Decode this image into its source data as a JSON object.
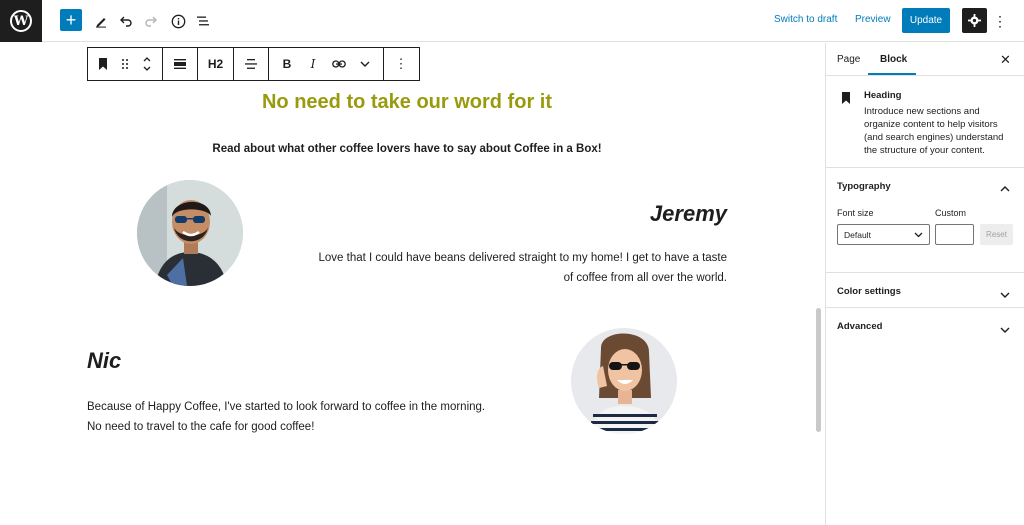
{
  "topbar": {
    "logo_letter": "W",
    "inserter_label": "+",
    "switch_to_draft": "Switch to draft",
    "preview": "Preview",
    "update": "Update"
  },
  "block_toolbar": {
    "heading_level": "H2",
    "bold": "B",
    "italic": "I"
  },
  "content": {
    "heading": "No need to take our word for it",
    "subheading": "Read about what other coffee lovers have to say about Coffee in a Box!",
    "testimonials": [
      {
        "name": "Jeremy",
        "quote_line1": "Love that I could have beans delivered straight to my home! I get to have a taste",
        "quote_line2": "of coffee from all over the world."
      },
      {
        "name": "Nic",
        "quote_line1": "Because of Happy Coffee, I've started to look forward to coffee in the morning.",
        "quote_line2": "No need to travel to the cafe for good coffee!"
      }
    ]
  },
  "sidebar": {
    "tabs": [
      "Page",
      "Block"
    ],
    "active_tab": "Block",
    "block_card": {
      "title": "Heading",
      "description": "Introduce new sections and organize content to help visitors (and search engines) understand the structure of your content."
    },
    "typography": {
      "title": "Typography",
      "font_size_label": "Font size",
      "custom_label": "Custom",
      "select_value": "Default",
      "reset_label": "Reset"
    },
    "color_settings": {
      "title": "Color settings"
    },
    "advanced": {
      "title": "Advanced"
    }
  },
  "colors": {
    "accent": "#007cba",
    "heading": "#9a9a0f",
    "dark": "#1e1e1e"
  }
}
